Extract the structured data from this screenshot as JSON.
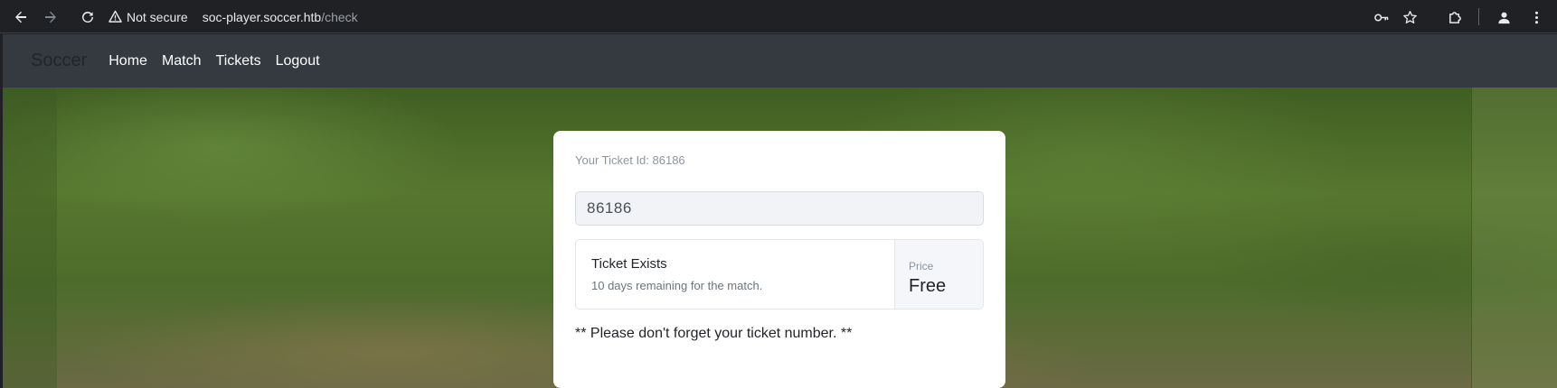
{
  "browser": {
    "security_label": "Not secure",
    "url_host": "soc-player.soccer.htb",
    "url_path": "/check"
  },
  "site": {
    "brand": "Soccer",
    "nav": [
      "Home",
      "Match",
      "Tickets",
      "Logout"
    ]
  },
  "ticket": {
    "id_label": "Your Ticket Id: 86186",
    "input_value": "86186",
    "status": "Ticket Exists",
    "remaining": "10 days remaining for the match.",
    "price_label": "Price",
    "price_value": "Free",
    "reminder": "** Please don't forget your ticket number. **"
  },
  "colors": {
    "chrome_bg": "#202124",
    "navbar_bg": "#343a40",
    "card_bg": "#ffffff"
  },
  "icons": [
    "back-icon",
    "forward-icon",
    "reload-icon",
    "warning-icon",
    "key-icon",
    "star-icon",
    "extensions-icon",
    "profile-icon",
    "more-icon"
  ]
}
